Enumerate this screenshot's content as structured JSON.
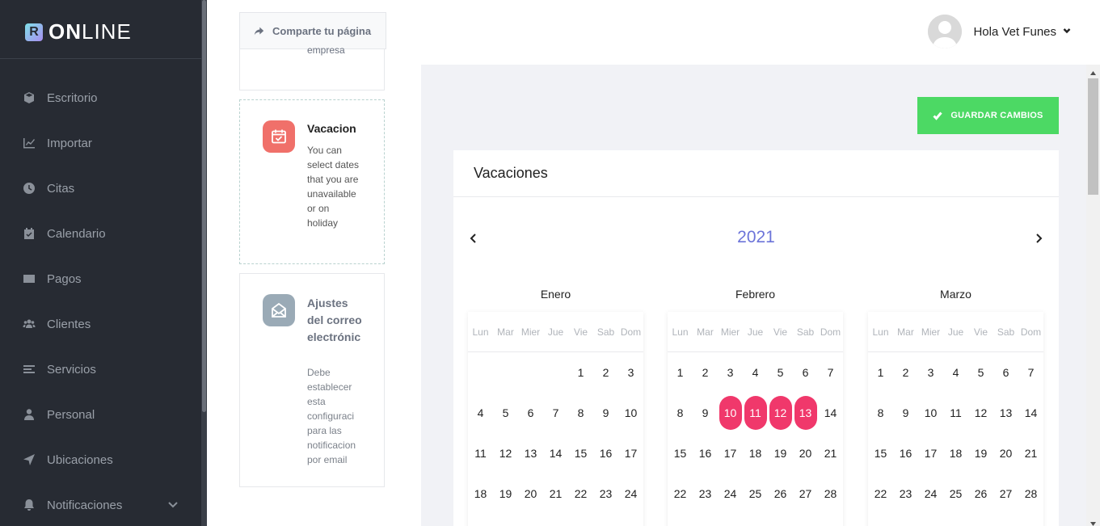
{
  "sidebar": {
    "logo_badge": "R",
    "logo_bold": "ON",
    "logo_light": "LINE",
    "items": [
      {
        "label": "Escritorio",
        "icon": "box-icon"
      },
      {
        "label": "Importar",
        "icon": "chart-icon"
      },
      {
        "label": "Citas",
        "icon": "clock-icon"
      },
      {
        "label": "Calendario",
        "icon": "calendar-icon"
      },
      {
        "label": "Pagos",
        "icon": "wallet-icon"
      },
      {
        "label": "Clientes",
        "icon": "users-icon"
      },
      {
        "label": "Servicios",
        "icon": "list-icon"
      },
      {
        "label": "Personal",
        "icon": "user-icon"
      },
      {
        "label": "Ubicaciones",
        "icon": "location-arrow-icon"
      },
      {
        "label": "Notificaciones",
        "icon": "bell-icon"
      }
    ]
  },
  "header": {
    "share_label": "Comparte tu página",
    "user_name": "Hola Vet Funes"
  },
  "cards": {
    "partial_text": "empresa",
    "vacation": {
      "title": "Vacacion",
      "description": "You can select dates that you are unavailable or on holiday",
      "icon": "calendar-check-icon",
      "color": "#f0706a"
    },
    "mail": {
      "title": "Ajustes del correo electrónic",
      "description": "Debe establecer esta configuraci para las notificacion por email",
      "icon": "envelope-open-icon",
      "color": "#9aaab6"
    }
  },
  "main": {
    "save_label": "GUARDAR CAMBIOS",
    "panel_title": "Vacaciones",
    "year": "2021",
    "weekdays": [
      "Lun",
      "Mar",
      "Mier",
      "Jue",
      "Vie",
      "Sab",
      "Dom"
    ],
    "months": [
      {
        "name": "Enero",
        "offset": 4,
        "days": [
          "1",
          "2",
          "3",
          "4",
          "5",
          "6",
          "7",
          "8",
          "9",
          "10",
          "11",
          "12",
          "13",
          "14",
          "15",
          "16",
          "17",
          "18",
          "19",
          "20",
          "21",
          "22",
          "23",
          "24"
        ],
        "selected": []
      },
      {
        "name": "Febrero",
        "offset": 0,
        "days": [
          "1",
          "2",
          "3",
          "4",
          "5",
          "6",
          "7",
          "8",
          "9",
          "10",
          "11",
          "12",
          "13",
          "14",
          "15",
          "16",
          "17",
          "18",
          "19",
          "20",
          "21",
          "22",
          "23",
          "24",
          "25",
          "26",
          "27",
          "28"
        ],
        "selected": [
          "10",
          "11",
          "12",
          "13"
        ]
      },
      {
        "name": "Marzo",
        "offset": 0,
        "days": [
          "1",
          "2",
          "3",
          "4",
          "5",
          "6",
          "7",
          "8",
          "9",
          "10",
          "11",
          "12",
          "13",
          "14",
          "15",
          "16",
          "17",
          "18",
          "19",
          "20",
          "21",
          "22",
          "23",
          "24",
          "25",
          "26",
          "27",
          "28"
        ],
        "selected": []
      }
    ],
    "colors": {
      "year": "#6c74d9",
      "selected_day": "#f0386b",
      "save_button": "#4cd964"
    }
  }
}
